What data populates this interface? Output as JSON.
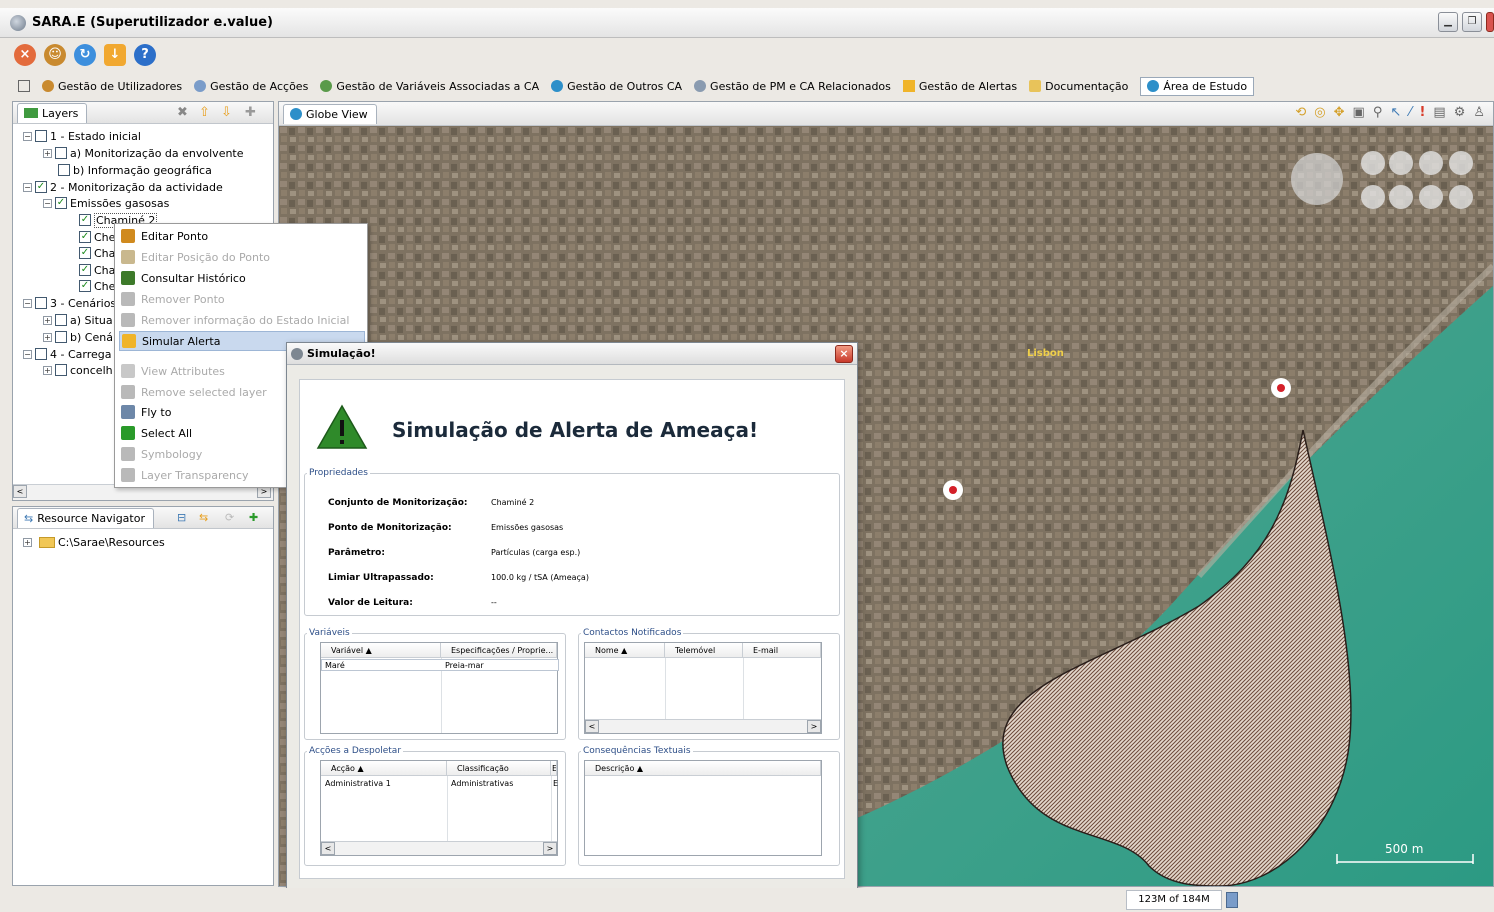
{
  "window": {
    "title": "SARA.E (Superutilizador e.value)",
    "controls": [
      "minimize",
      "maximize",
      "close"
    ]
  },
  "toolbar": {
    "icons": [
      "exit-icon",
      "users-icon",
      "refresh-icon",
      "download-icon",
      "help-icon"
    ]
  },
  "menu": {
    "items": [
      {
        "label": "Gestão de Utilizadores",
        "icon": "users-icon"
      },
      {
        "label": "Gestão de Acções",
        "icon": "actions-icon"
      },
      {
        "label": "Gestão de Variáveis Associadas a CA",
        "icon": "variables-icon"
      },
      {
        "label": "Gestão de Outros CA",
        "icon": "globe-icon"
      },
      {
        "label": "Gestão de PM e CA Relacionados",
        "icon": "pm-icon"
      },
      {
        "label": "Gestão de Alertas",
        "icon": "alert-icon"
      },
      {
        "label": "Documentação",
        "icon": "doc-icon"
      },
      {
        "label": "Área de Estudo",
        "icon": "globe-icon",
        "active": true
      }
    ]
  },
  "layers": {
    "tab_label": "Layers",
    "tree": [
      {
        "label": "1 - Estado inicial",
        "checked": false,
        "expanded": true
      },
      {
        "label": "a) Monitorização da envolvente",
        "checked": false,
        "expanded": false
      },
      {
        "label": "b) Informação geográfica",
        "checked": false
      },
      {
        "label": "2 - Monitorização da actividade",
        "checked": true,
        "expanded": true
      },
      {
        "label": "Emissões gasosas",
        "checked": true,
        "expanded": true
      },
      {
        "label": "Chaminé 2",
        "checked": true,
        "selected": true
      },
      {
        "label": "Che",
        "checked": true
      },
      {
        "label": "Cha",
        "checked": true
      },
      {
        "label": "Cha",
        "checked": true
      },
      {
        "label": "Che",
        "checked": true
      },
      {
        "label": "3 - Cenários",
        "checked": false,
        "expanded": true
      },
      {
        "label": "a) Situa",
        "checked": false,
        "expanded": false
      },
      {
        "label": "b) Cená",
        "checked": false,
        "expanded": false
      },
      {
        "label": "4 - Carrega",
        "checked": false,
        "expanded": true
      },
      {
        "label": "concelh",
        "checked": false,
        "expanded": false
      }
    ]
  },
  "context_menu": {
    "items": [
      {
        "label": "Editar Ponto",
        "enabled": true,
        "icon": "pencil-icon",
        "color": "#d08a1e"
      },
      {
        "label": "Editar Posição do Ponto",
        "enabled": false,
        "icon": "move-point-icon",
        "color": "#c9b88e"
      },
      {
        "label": "Consultar Histórico",
        "enabled": true,
        "icon": "bar-chart-icon",
        "color": "#3d7a2a"
      },
      {
        "label": "Remover Ponto",
        "enabled": false,
        "icon": "remove-point-icon",
        "color": "#b9b9b9"
      },
      {
        "label": "Remover informação do Estado Inicial",
        "enabled": false,
        "icon": "remove-info-icon",
        "color": "#b9b9b9"
      },
      {
        "label": "Simular Alerta",
        "enabled": true,
        "selected": true,
        "icon": "warning-icon",
        "color": "#f0b429"
      },
      {
        "label": "View Attributes",
        "enabled": false,
        "icon": "magnifier-icon",
        "color": "#c8c8c8"
      },
      {
        "label": "Remove selected layer",
        "enabled": false,
        "icon": "x-icon",
        "color": "#b9b9b9"
      },
      {
        "label": "Fly to",
        "enabled": true,
        "icon": "fly-to-icon",
        "color": "#6d87a8"
      },
      {
        "label": "Select All",
        "enabled": true,
        "icon": "checkmark-icon",
        "color": "#2a9a2a"
      },
      {
        "label": "Symbology",
        "enabled": false,
        "icon": "symbology-icon",
        "color": "#b9b9b9"
      },
      {
        "label": "Layer Transparency",
        "enabled": false,
        "icon": "transparency-icon",
        "color": "#b9b9b9"
      }
    ]
  },
  "resource_navigator": {
    "tab_label": "Resource Navigator",
    "items": [
      {
        "label": "C:\\Sarae\\Resources"
      }
    ]
  },
  "globe": {
    "tab_label": "Globe View",
    "place_label": "Lisbon",
    "scale_label": "500 m"
  },
  "dialog": {
    "title": "Simulação!",
    "heading": "Simulação de Alerta de Ameaça!",
    "properties": {
      "legend": "Propriedades",
      "rows": [
        {
          "label": "Conjunto de Monitorização:",
          "value": "Chaminé 2"
        },
        {
          "label": "Ponto de Monitorização:",
          "value": "Emissões gasosas"
        },
        {
          "label": "Parâmetro:",
          "value": "Partículas (carga esp.)"
        },
        {
          "label": "Limiar Ultrapassado:",
          "value": "100.0 kg / tSA  (Ameaça)"
        },
        {
          "label": "Valor de Leitura:",
          "value": "--"
        }
      ]
    },
    "variaveis": {
      "legend": "Variáveis",
      "columns": [
        "Variável",
        "Especificações / Proprie..."
      ],
      "rows": [
        [
          "Maré",
          "Preia-mar"
        ]
      ]
    },
    "contactos": {
      "legend": "Contactos Notificados",
      "columns": [
        "Nome",
        "Telemóvel",
        "E-mail"
      ],
      "rows": []
    },
    "accoes": {
      "legend": "Acções a Despoletar",
      "columns": [
        "Acção",
        "Classificação",
        "E"
      ],
      "rows": [
        [
          "Administrativa 1",
          "Administrativas",
          "E"
        ]
      ]
    },
    "consequencias": {
      "legend": "Consequências Textuais",
      "columns": [
        "Descrição"
      ],
      "rows": []
    }
  },
  "status": {
    "memory": "123M of 184M"
  }
}
